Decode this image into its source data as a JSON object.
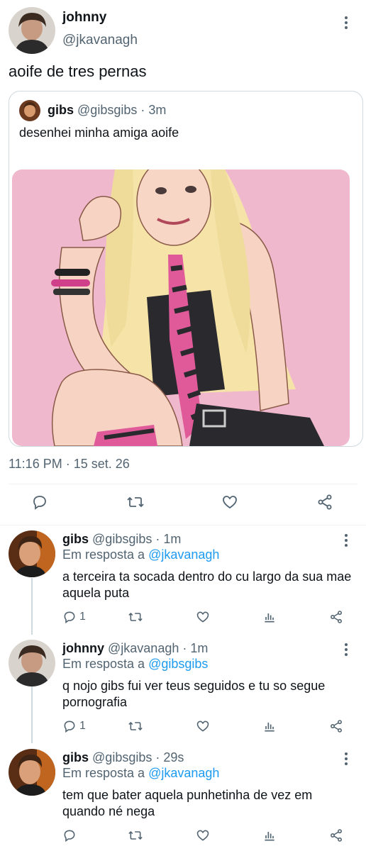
{
  "main_tweet": {
    "name": "johnny",
    "handle": "@jkavanagh",
    "text": "aoife de tres pernas",
    "quote": {
      "name": "gibs",
      "handle": "@gibsgibs",
      "time": "· 3m",
      "text": "desenhei minha amiga aoife"
    },
    "timestamp": "11:16 PM · 15 set. 26"
  },
  "replies": [
    {
      "name": "gibs",
      "handle": "@gibsgibs",
      "time": "· 1m",
      "reply_prefix": "Em resposta a",
      "reply_to": "@jkavanagh",
      "text": "a terceira ta socada dentro do cu largo da sua mae aquela puta",
      "reply_count": "1"
    },
    {
      "name": "johnny",
      "handle": "@jkavanagh",
      "time": "· 1m",
      "reply_prefix": "Em resposta a",
      "reply_to": "@gibsgibs",
      "text": "q nojo gibs fui ver teus seguidos e tu so segue pornografia",
      "reply_count": "1"
    },
    {
      "name": "gibs",
      "handle": "@gibsgibs",
      "time": "· 29s",
      "reply_prefix": "Em resposta a",
      "reply_to": "@jkavanagh",
      "text": "tem que bater aquela punhetinha de vez em quando né nega",
      "reply_count": ""
    }
  ],
  "icons": {
    "reply": "reply-icon",
    "retweet": "retweet-icon",
    "like": "like-icon",
    "analytics": "analytics-icon",
    "share": "share-icon",
    "more": "more-icon"
  },
  "colors": {
    "text": "#0f1419",
    "secondary": "#536471",
    "link": "#1d9bf0",
    "border": "#cfd9de",
    "image_bg": "#f0b8cc"
  }
}
